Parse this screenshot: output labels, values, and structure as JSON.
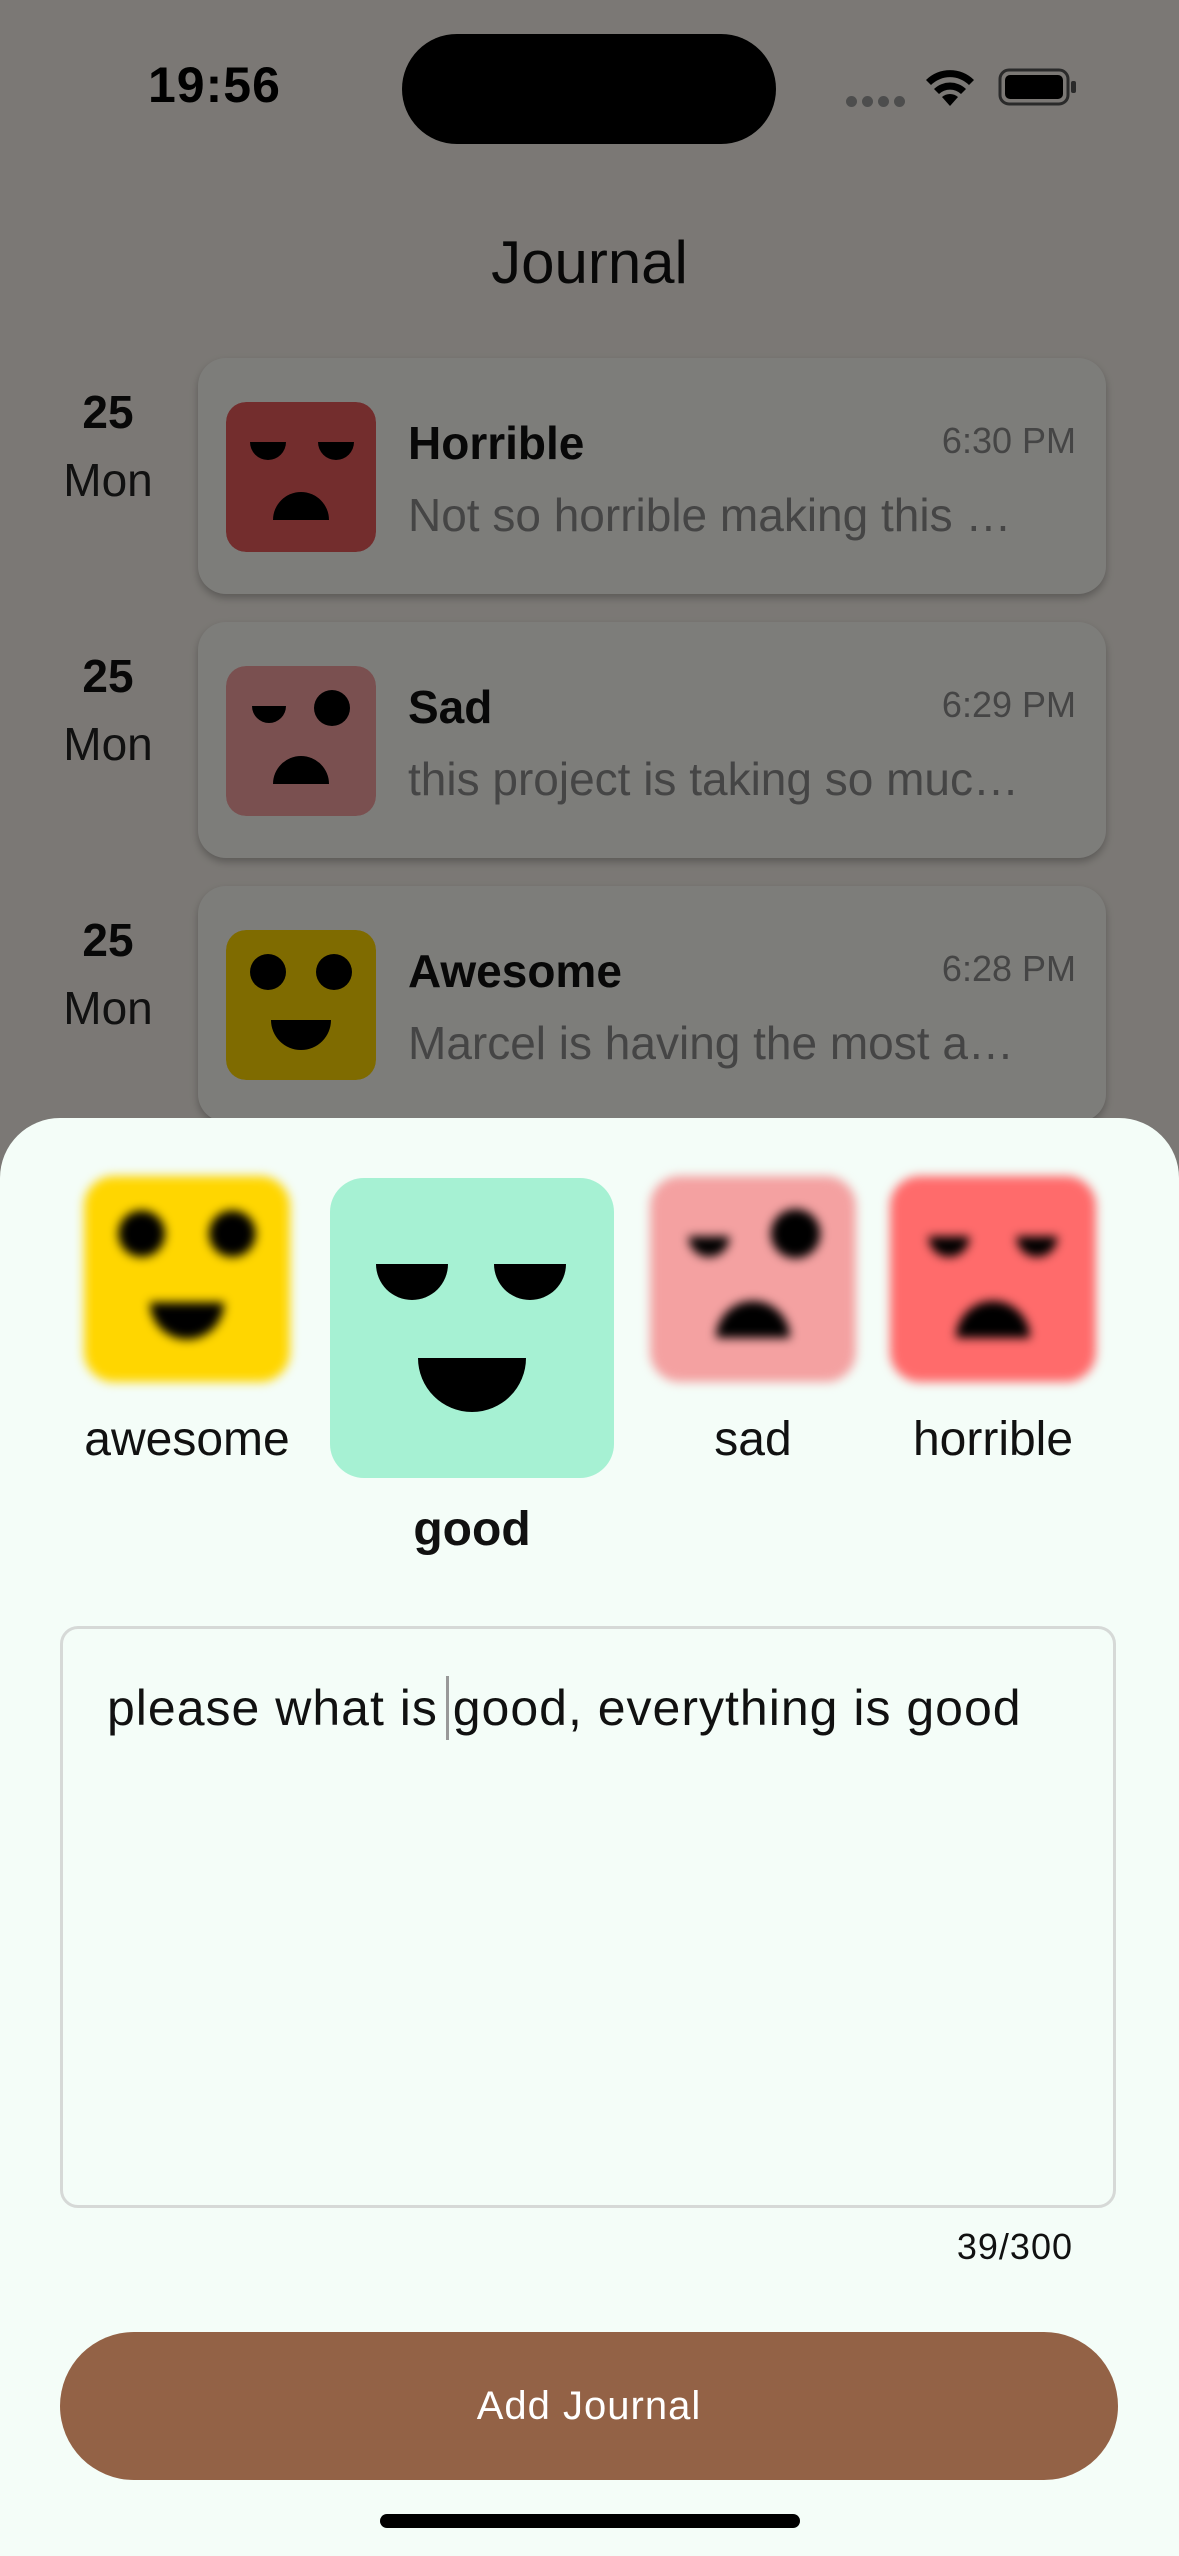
{
  "status": {
    "time": "19:56"
  },
  "colors": {
    "horrible": "#e75a5a",
    "sad": "#f4a1a1",
    "awesome": "#ffd600",
    "good": "#a6f1d3",
    "button": "#936246",
    "sheet": "#f4fdf8"
  },
  "header": {
    "title": "Journal"
  },
  "entries": [
    {
      "day": "25",
      "weekday": "Mon",
      "mood": "Horrible",
      "time": "6:30 PM",
      "snippet": "Not so horrible making this …",
      "icon": "horrible-face-icon"
    },
    {
      "day": "25",
      "weekday": "Mon",
      "mood": "Sad",
      "time": "6:29 PM",
      "snippet": "this project is taking so muc…",
      "icon": "sad-face-icon"
    },
    {
      "day": "25",
      "weekday": "Mon",
      "mood": "Awesome",
      "time": "6:28 PM",
      "snippet": "Marcel is having the most a…",
      "icon": "awesome-face-icon"
    }
  ],
  "sheet": {
    "moods": [
      {
        "label": "awesome",
        "icon": "awesome-face-icon",
        "selected": false
      },
      {
        "label": "good",
        "icon": "good-face-icon",
        "selected": true
      },
      {
        "label": "sad",
        "icon": "sad-face-icon",
        "selected": false
      },
      {
        "label": "horrible",
        "icon": "horrible-face-icon",
        "selected": false
      }
    ],
    "text": "please what is good, everything is good",
    "counter": "39/300",
    "button_label": "Add Journal"
  }
}
